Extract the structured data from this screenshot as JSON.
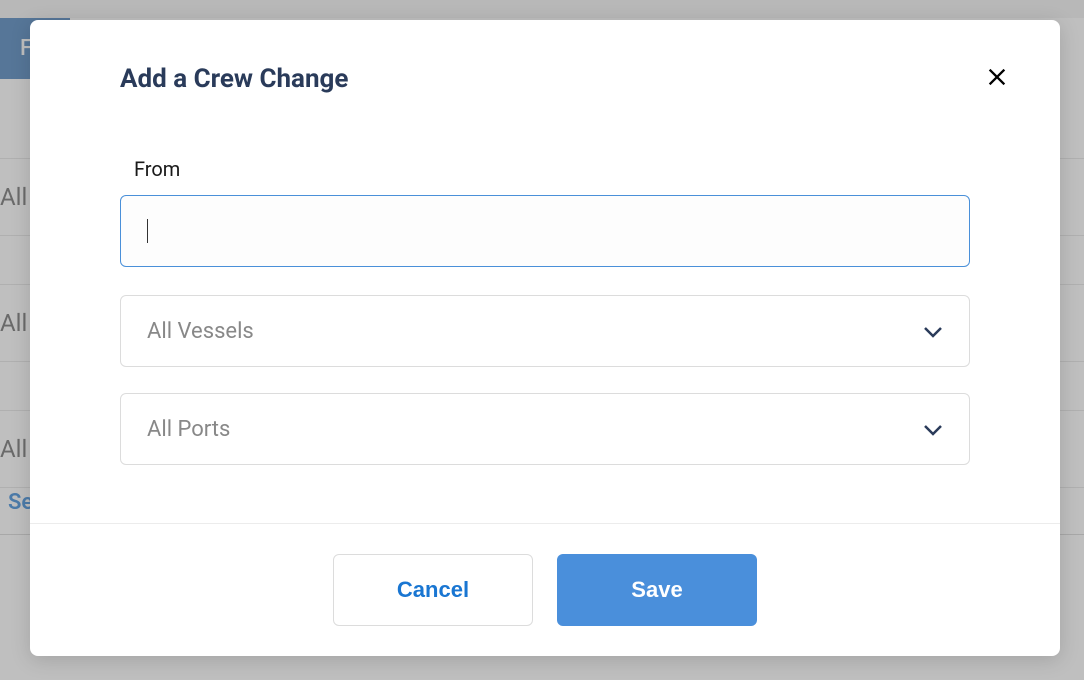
{
  "background": {
    "tab_label": "Fla",
    "filter1": "All V",
    "filter2": "All E",
    "filter3": "All S",
    "link": "Se"
  },
  "modal": {
    "title": "Add a Crew Change",
    "from_label": "From",
    "from_value": "",
    "vessel_select": "All Vessels",
    "port_select": "All Ports",
    "cancel_label": "Cancel",
    "save_label": "Save"
  }
}
